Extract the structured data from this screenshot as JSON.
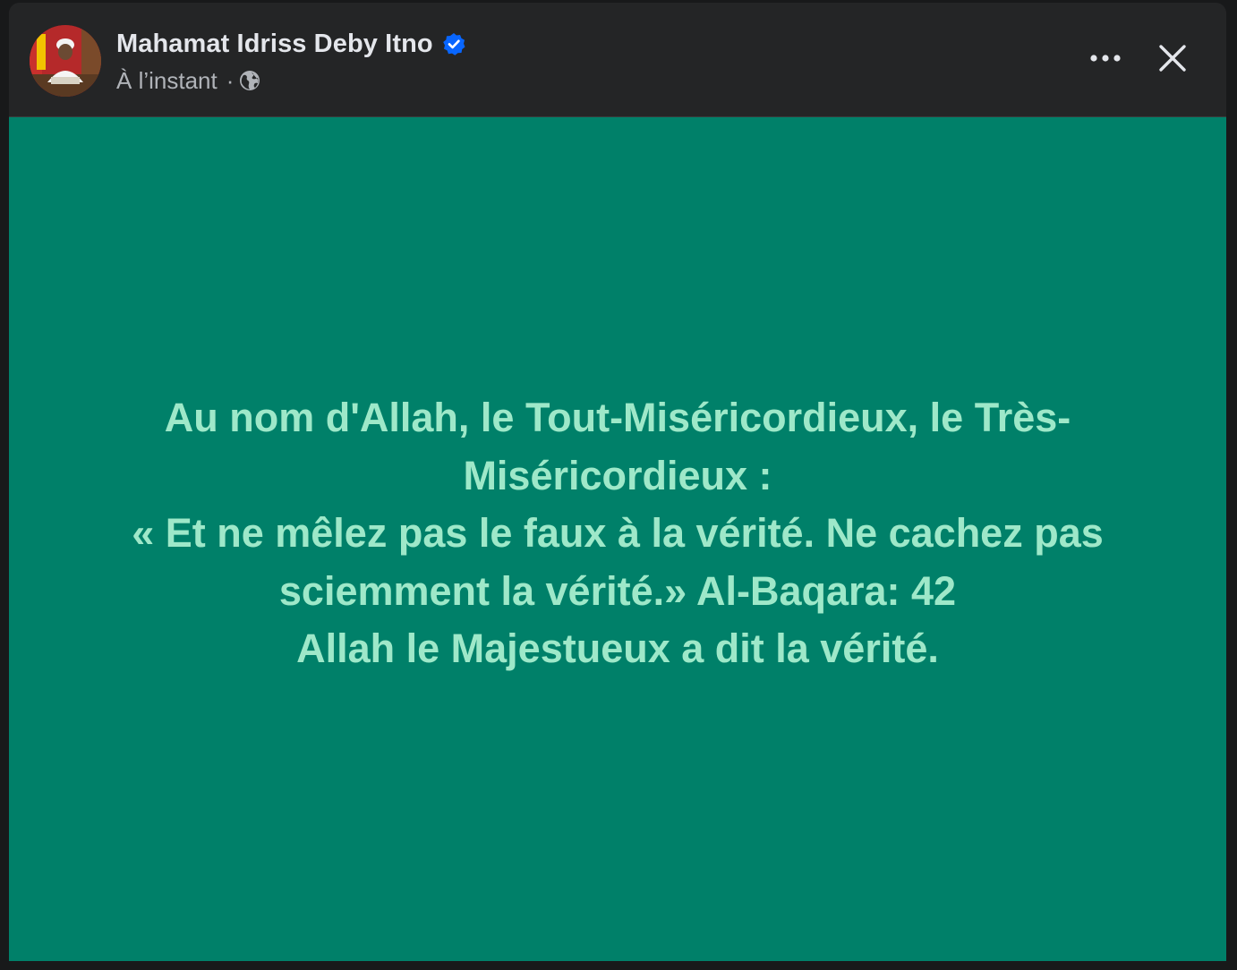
{
  "author": {
    "name": "Mahamat Idriss Deby Itno",
    "verified": true
  },
  "meta": {
    "time": "À l’instant",
    "separator": "·",
    "audience_icon": "globe-icon"
  },
  "actions": {
    "more_icon": "more-options-icon",
    "close_icon": "close-icon"
  },
  "post": {
    "text": "Au nom d'Allah, le Tout-Miséricordieux, le Très-Miséricordieux :\n« Et ne mêlez pas le faux à la vérité. Ne cachez pas sciemment la vérité.» Al-Baqara: 42\nAllah le Majestueux a dit la vérité.",
    "background_color": "#008069",
    "text_color": "#9ee8c9"
  },
  "colors": {
    "header_bg": "#242526",
    "verified_blue": "#0866ff"
  }
}
